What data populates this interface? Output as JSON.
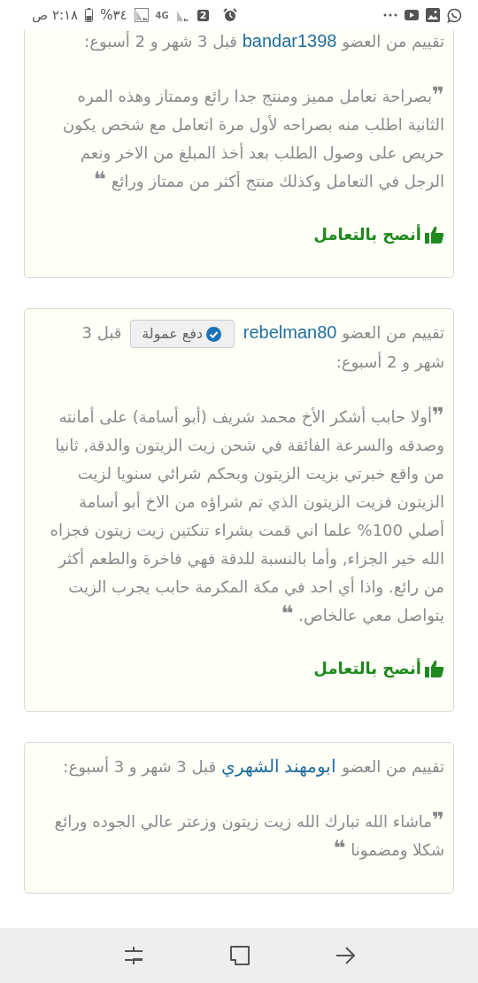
{
  "status_bar": {
    "time": "٢:١٨ ص",
    "battery": "٣٤%",
    "network": "4G",
    "sim": "2"
  },
  "reviews": [
    {
      "prefix": "تقييم من العضو",
      "member": "bandar1398",
      "time_ago": "قبل 3 شهر و 2 أسبوع:",
      "text": "**❞**بصراحة تعامل مميز ومنتج جدا رائع وممتاز وهذه المره الثانية اطلب منه بصراحه لأول مرة اتعامل مع شخص يكون حريص على وصول الطلب بعد أخذ المبلغ من الاخر ونعم الرجل في التعامل وكذلك منتج أكثر من ممتاز ورائع **❝**",
      "recommend": "أنصح بالتعامل"
    },
    {
      "prefix": "تقييم من العضو",
      "member": "rebelman80",
      "badge": "دفع عمولة",
      "time_ago": "قبل 3 شهر و 2 أسبوع:",
      "text": "**❞**أولا حابب أشكر الأخ محمد شريف (أبو أسامة) على أمانته وصدقه والسرعة الفائقة في شحن زيت الزيتون والدقة, ثانيا من واقع خبرتي بزيت الزيتون وبحكم شرائي سنويا لزيت الزيتون فزيت الزيتون الذي تم شراؤه من الاخ أبو أسامة أصلي 100% علما اني قمت بشراء تنكتين زيت زيتون فجزاه الله خير الجزاء, وأما بالنسبة للدقة فهي فاخرة والطعم أكثر من رائع. واذا أي احد في مكة المكرمة حابب يجرب الزيت يتواصل معي عالخاص. **❝**",
      "recommend": "أنصح بالتعامل"
    },
    {
      "prefix": "تقييم من العضو",
      "member": "ابومهند الشهري",
      "time_ago": "قبل 3 شهر و 3 أسبوع:",
      "text": "**❞**ماشاء الله تبارك الله زيت زيتون وزعتر عالي الجوده ورائع شكلا ومضمونا **❝**"
    }
  ]
}
